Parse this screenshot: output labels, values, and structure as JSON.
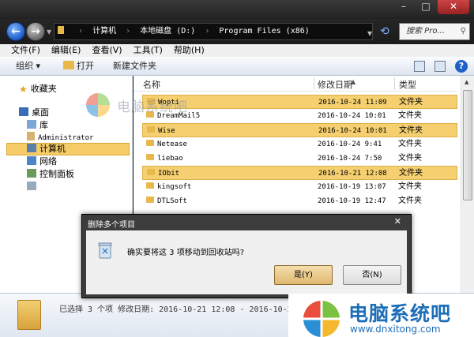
{
  "window": {
    "close_label": "✕",
    "maximize_label": "□",
    "minimize_label": "–"
  },
  "address": {
    "path": [
      "计算机",
      "本地磁盘 (D:)",
      "Program Files (x86)"
    ],
    "search_placeholder": "搜索 Pro..."
  },
  "menu": [
    "文件(F)",
    "编辑(E)",
    "查看(V)",
    "工具(T)",
    "帮助(H)"
  ],
  "toolbar": {
    "organize": "组织 ▾",
    "open": "打开",
    "new_folder": "新建文件夹"
  },
  "nav": {
    "favorites": "收藏夹",
    "desktop": "桌面",
    "libraries": "库",
    "administrator": "Administrator",
    "computer": "计算机",
    "network": "网络",
    "control_panel": "控制面板"
  },
  "columns": {
    "name": "名称",
    "date": "修改日期",
    "type": "类型"
  },
  "files": [
    {
      "name": "Wopti",
      "date": "2016-10-24 11:09",
      "type": "文件夹",
      "selected": true
    },
    {
      "name": "DreamMail5",
      "date": "2016-10-24 10:01",
      "type": "文件夹",
      "selected": false
    },
    {
      "name": "Wise",
      "date": "2016-10-24 10:01",
      "type": "文件夹",
      "selected": true
    },
    {
      "name": "Netease",
      "date": "2016-10-24 9:41",
      "type": "文件夹",
      "selected": false
    },
    {
      "name": "liebao",
      "date": "2016-10-24 7:50",
      "type": "文件夹",
      "selected": false
    },
    {
      "name": "IObit",
      "date": "2016-10-21 12:08",
      "type": "文件夹",
      "selected": true
    },
    {
      "name": "kingsoft",
      "date": "2016-10-19 13:07",
      "type": "文件夹",
      "selected": false
    },
    {
      "name": "DTLSoft",
      "date": "2016-10-19 12:47",
      "type": "文件夹",
      "selected": false
    }
  ],
  "details": {
    "text": "已选择 3 个项 修改日期: 2016-10-21 12:08 - 2016-10-24 11:09"
  },
  "dialog": {
    "title": "删除多个项目",
    "close": "✕",
    "message": "确实要将这 3 项移动到回收站吗?",
    "yes": "是(Y)",
    "no": "否(N)"
  },
  "watermark": {
    "text": "电脑系统吧",
    "brand_name": "电脑系统吧",
    "brand_url": "www.dnxitong.com"
  },
  "colors": {
    "selection": "#f5cf70",
    "accent_blue": "#1d6eb8"
  }
}
